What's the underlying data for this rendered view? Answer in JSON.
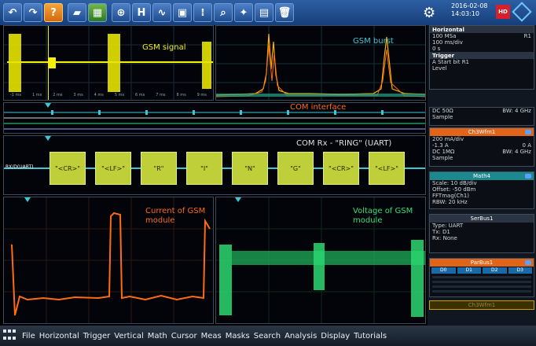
{
  "toolbar": {
    "help_label": "?",
    "hist_label": "H",
    "datetime_line1": "2016-02-08",
    "datetime_line2": "14:03:10",
    "badge": "HD"
  },
  "panels": {
    "gsm_signal": {
      "label": "GSM signal",
      "time_ticks": [
        "-1 ms",
        "1 ms",
        "2 ms",
        "3 ms",
        "4 ms",
        "5 ms",
        "6 ms",
        "7 ms",
        "8 ms",
        "9 ms"
      ]
    },
    "gsm_burst": {
      "label": "GSM burst"
    },
    "com_interface": {
      "label": "COM interface"
    },
    "com_rx": {
      "label": "COM  Rx - \"RING\" (UART)",
      "bus_label": "RX/D(UART)",
      "frames": [
        "\"<CR>\"",
        "\"<LF>\"",
        "\"R\"",
        "\"I\"",
        "\"N\"",
        "\"G\"",
        "\"<CR>\"",
        "\"<LF>\""
      ]
    },
    "current": {
      "label_line1": "Current of GSM",
      "label_line2": "module"
    },
    "voltage": {
      "label_line1": "Voltage of GSM",
      "label_line2": "module"
    }
  },
  "side": {
    "horizontal": {
      "title": "Horizontal",
      "rows": [
        [
          "100 MSa",
          "R1"
        ],
        [
          "100 ms/div",
          ""
        ],
        [
          "0 s",
          ""
        ]
      ],
      "trigger_title": "Trigger",
      "trigger_rows": [
        [
          "A  Start bit R1",
          ""
        ],
        [
          "Level",
          ""
        ]
      ]
    },
    "ch3": {
      "title": "Ch3Wfm1",
      "rows": [
        [
          "200 mA/div",
          ""
        ],
        [
          "-1.3 A",
          "0 A"
        ],
        [
          "DC 1MΩ",
          "BW: 4 GHz"
        ],
        [
          "Sample",
          ""
        ]
      ],
      "pre_rows": [
        [
          "DC 50Ω",
          "BW: 4 GHz"
        ],
        [
          "Sample",
          ""
        ]
      ]
    },
    "math4": {
      "title": "Math4",
      "rows": [
        [
          "Scale:  10 dB/div",
          ""
        ],
        [
          "Offset: -50 dBm",
          ""
        ],
        [
          "FFTmag(Ch1)",
          ""
        ],
        [
          "RBW:     20 kHz",
          ""
        ]
      ]
    },
    "serbus": {
      "title": "SerBus1",
      "rows": [
        [
          "Type: UART",
          ""
        ],
        [
          "Tx: D1",
          ""
        ],
        [
          "Rx: None",
          ""
        ]
      ]
    },
    "parbus": {
      "title": "ParBus1",
      "cells": [
        "D0",
        "D1",
        "D2",
        "D3"
      ]
    },
    "ch3wfm_bottom": {
      "title": "Ch3Wfm1"
    }
  },
  "menu": {
    "items": [
      "File",
      "Horizontal",
      "Trigger",
      "Vertical",
      "Math",
      "Cursor",
      "Meas",
      "Masks",
      "Search",
      "Analysis",
      "Display",
      "Tutorials"
    ]
  },
  "colors": {
    "yellow": "#f4f000",
    "orange": "#ff6a13",
    "green": "#31e07a",
    "cyan": "#3ec6d6",
    "uart": "#bfcf3a"
  }
}
